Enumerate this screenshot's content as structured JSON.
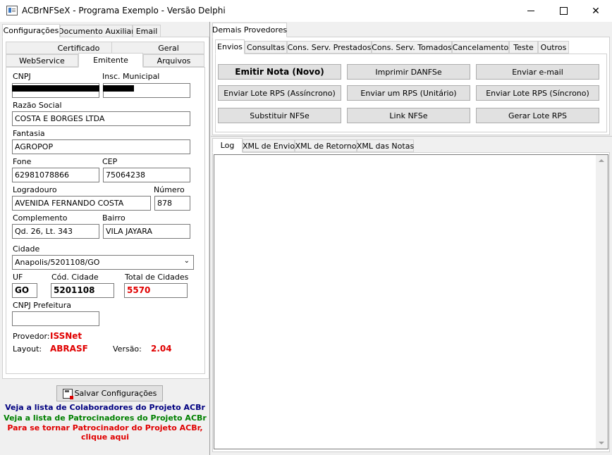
{
  "window": {
    "title": "ACBrNFSeX - Programa Exemplo - Versão Delphi"
  },
  "left_tabs": [
    "Configurações",
    "Documento Auxiliar",
    "Email"
  ],
  "config_tabs_row1": [
    "Certificado",
    "Geral"
  ],
  "config_tabs_row2": [
    "WebService",
    "Emitente",
    "Arquivos"
  ],
  "emitente": {
    "cnpj_label": "CNPJ",
    "inscricao_label": "Insc. Municipal",
    "razao_label": "Razão Social",
    "razao_value": "COSTA E BORGES LTDA",
    "fantasia_label": "Fantasia",
    "fantasia_value": "AGROPOP",
    "fone_label": "Fone",
    "fone_value": "62981078866",
    "cep_label": "CEP",
    "cep_value": "75064238",
    "logradouro_label": "Logradouro",
    "logradouro_value": "AVENIDA  FERNANDO COSTA",
    "numero_label": "Número",
    "numero_value": "878",
    "complemento_label": "Complemento",
    "complemento_value": "Qd. 26, Lt. 343",
    "bairro_label": "Bairro",
    "bairro_value": "VILA JAYARA",
    "cidade_label": "Cidade",
    "cidade_value": "Anapolis/5201108/GO",
    "uf_label": "UF",
    "uf_value": "GO",
    "cod_cidade_label": "Cód. Cidade",
    "cod_cidade_value": "5201108",
    "total_cidades_label": "Total de Cidades",
    "total_cidades_value": "5570",
    "cnpj_prefeitura_label": "CNPJ Prefeitura",
    "cnpj_prefeitura_value": "",
    "provedor_label": "Provedor:",
    "provedor_value": "ISSNet",
    "layout_label": "Layout:",
    "layout_value": "ABRASF",
    "versao_label": "Versão:",
    "versao_value": "2.04"
  },
  "save_button": "Salvar Configurações",
  "links": {
    "colaboradores": "Veja a lista de Colaboradores do Projeto ACBr",
    "patrocinadores": "Veja a lista de Patrocinadores do Projeto ACBr",
    "tornar_line1": "Para se tornar Patrocinador do Projeto ACBr,",
    "tornar_line2": "clique aqui"
  },
  "link_colors": {
    "colaboradores": "#000080",
    "patrocinadores": "#008000",
    "tornar": "#e00000"
  },
  "right_top_tab": "Demais Provedores",
  "action_tabs": [
    "Envios",
    "Consultas",
    "Cons. Serv. Prestados",
    "Cons. Serv. Tomados",
    "Cancelamento",
    "Teste",
    "Outros"
  ],
  "buttons": {
    "emitir": "Emitir Nota (Novo)",
    "imprimir": "Imprimir DANFSe",
    "email": "Enviar e-mail",
    "lote_async": "Enviar Lote RPS (Assíncrono)",
    "um_rps": "Enviar um RPS (Unitário)",
    "lote_sync": "Enviar Lote RPS (Síncrono)",
    "substituir": "Substituir NFSe",
    "link": "Link NFSe",
    "gerar": "Gerar Lote RPS"
  },
  "log_tabs": [
    "Log",
    "XML de Envio",
    "XML de Retorno",
    "XML das Notas"
  ]
}
